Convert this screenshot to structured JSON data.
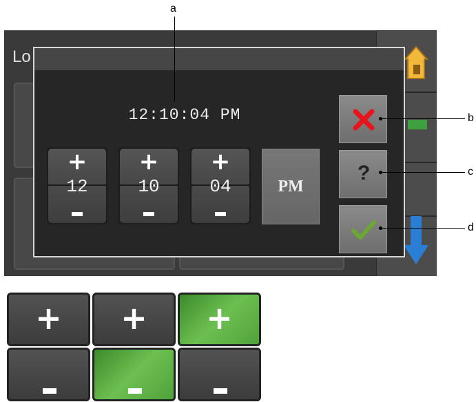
{
  "background": {
    "title": "Lo"
  },
  "dialog": {
    "time_display": "12:10:04 PM",
    "spinners": [
      {
        "name": "hours",
        "plus": "+",
        "value": "12"
      },
      {
        "name": "minutes",
        "plus": "+",
        "value": "10"
      },
      {
        "name": "seconds",
        "plus": "+",
        "value": "04"
      }
    ],
    "ampm_label": "PM",
    "help_label": "?"
  },
  "callouts": {
    "a": "a",
    "b": "b",
    "c": "c",
    "d": "d"
  },
  "example": {
    "plus": "+",
    "highlight_states": [
      {
        "column": 1,
        "highlighted": "none"
      },
      {
        "column": 2,
        "highlighted": "minus"
      },
      {
        "column": 3,
        "highlighted": "plus"
      }
    ]
  },
  "colors": {
    "dialog_bg": "#262626",
    "dialog_border": "#d8d8d8",
    "cancel_x": "#e8141c",
    "confirm_check": "#6aa832",
    "home_icon": "#f2b83c",
    "down_arrow": "#2a7fd4",
    "green_indicator": "#3fa03f",
    "highlight_green": "#5cb046"
  }
}
